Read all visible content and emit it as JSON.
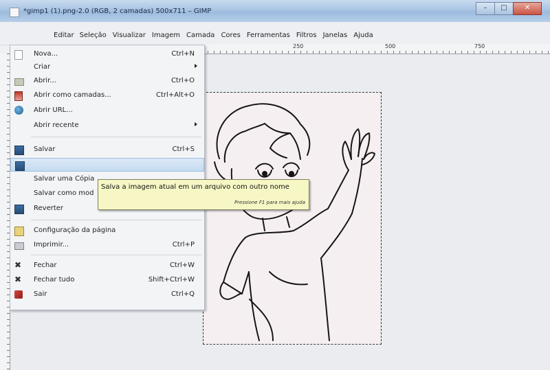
{
  "window": {
    "title": "*gimp1 (1).png-2.0 (RGB, 2 camadas) 500x711 – GIMP",
    "controls": [
      "–",
      "□",
      "✕"
    ]
  },
  "menubar": {
    "items": [
      "Editar",
      "Seleção",
      "Visualizar",
      "Imagem",
      "Camada",
      "Cores",
      "Ferramentas",
      "Filtros",
      "Janelas",
      "Ajuda"
    ]
  },
  "ruler": {
    "labels": [
      "250",
      "500",
      "750"
    ]
  },
  "file_menu": {
    "items": [
      {
        "label": "Nova...",
        "shortcut": "Ctrl+N",
        "icon": "new-document-icon"
      },
      {
        "label": "Criar",
        "shortcut": "",
        "submenu": true
      },
      {
        "label": "Abrir...",
        "shortcut": "Ctrl+O",
        "icon": "open-folder-icon"
      },
      {
        "label": "Abrir como camadas...",
        "shortcut": "Ctrl+Alt+O",
        "icon": "open-layers-icon"
      },
      {
        "label": "Abrir URL...",
        "shortcut": "",
        "icon": "globe-icon"
      },
      {
        "label": "Abrir recente",
        "shortcut": "",
        "submenu": true
      },
      {
        "label": "Salvar",
        "shortcut": "Ctrl+S",
        "icon": "save-icon"
      },
      {
        "label": "",
        "shortcut": "",
        "icon": "save-as-icon",
        "highlighted": true
      },
      {
        "label": "Salvar uma Cópia",
        "shortcut": ""
      },
      {
        "label": "Salvar como mod",
        "shortcut": ""
      },
      {
        "label": "Reverter",
        "shortcut": "",
        "icon": "revert-icon"
      },
      {
        "label": "Configuração da página",
        "shortcut": "",
        "icon": "page-setup-icon"
      },
      {
        "label": "Imprimir...",
        "shortcut": "Ctrl+P",
        "icon": "printer-icon"
      },
      {
        "label": "Fechar",
        "shortcut": "Ctrl+W",
        "icon": "close-icon"
      },
      {
        "label": "Fechar tudo",
        "shortcut": "Shift+Ctrl+W",
        "icon": "close-all-icon"
      },
      {
        "label": "Sair",
        "shortcut": "Ctrl+Q",
        "icon": "quit-icon"
      }
    ]
  },
  "tooltip": {
    "text": "Salva a imagem atual em um arquivo com outro nome",
    "hint": "Pressione F1 para mais ajuda"
  },
  "colors": {
    "menu_bg": "#f3f4f6",
    "highlight": "#c6dbf1",
    "tooltip_bg": "#f7f7c6",
    "titlebar": "#a8c4e3"
  }
}
